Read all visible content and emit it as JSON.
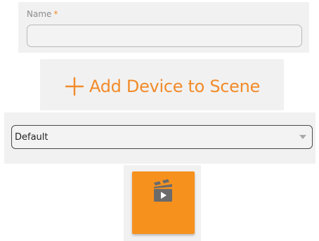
{
  "name_field": {
    "label": "Name",
    "required_marker": "*",
    "value": "",
    "placeholder": ""
  },
  "add_device": {
    "label": "Add Device to Scene",
    "icon": "plus-icon"
  },
  "scene_select": {
    "selected": "Default",
    "icon": "chevron-down-icon"
  },
  "scene_tile": {
    "icon": "clapperboard-play-icon"
  },
  "colors": {
    "accent": "#f7911e",
    "panel_bg": "#f1f1f1",
    "label_text": "#8c8c8c"
  }
}
